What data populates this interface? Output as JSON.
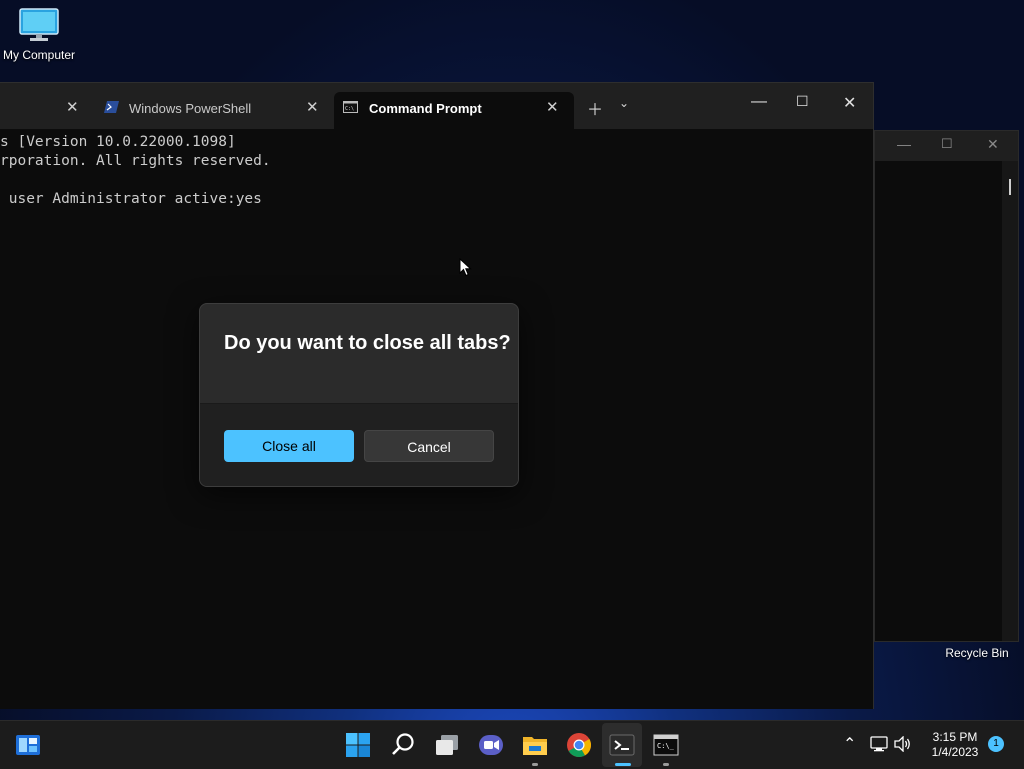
{
  "desktop": {
    "icons": [
      {
        "label": "My Computer"
      },
      {
        "label": "Recycle Bin"
      }
    ]
  },
  "terminal": {
    "tabs": [
      {
        "label": ""
      },
      {
        "label": "Windows PowerShell"
      },
      {
        "label": "Command Prompt"
      }
    ],
    "console_lines": [
      "s [Version 10.0.22000.1098]",
      "rporation. All rights reserved.",
      "",
      " user Administrator active:yes"
    ]
  },
  "dialog": {
    "title": "Do you want to close all tabs?",
    "primary_label": "Close all",
    "secondary_label": "Cancel"
  },
  "taskbar": {
    "time": "3:15 PM",
    "date": "1/4/2023",
    "notification_count": "1"
  },
  "colors": {
    "accent": "#4cc2ff",
    "terminal_bg": "#0c0c0c",
    "dialog_bg": "#2b2b2b"
  }
}
